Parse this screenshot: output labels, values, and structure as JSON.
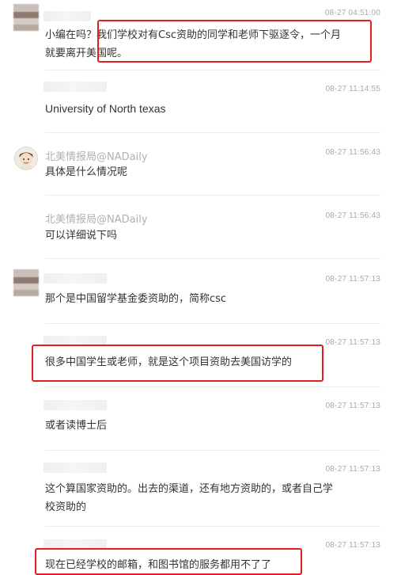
{
  "comments": [
    {
      "time": "08-27 04:51:00",
      "text_line1": "小编在吗？我们学校对有Csc资助的同学和老师下驱逐令，一个月",
      "text_line2": "就要离开美国呢。"
    },
    {
      "time": "08-27 11:14:55",
      "text": "University of North texas"
    },
    {
      "name": "北美情报局@NADaily",
      "time": "08-27 11:56:43",
      "text": "具体是什么情况呢"
    },
    {
      "name": "北美情报局@NADaily",
      "time": "08-27 11:56:43",
      "text": "可以详细说下吗"
    },
    {
      "time": "08-27 11:57:13",
      "text": "那个是中国留学基金委资助的，简称csc"
    },
    {
      "time": "08-27 11:57:13",
      "text": "很多中国学生或老师，就是这个项目资助去美国访学的"
    },
    {
      "time": "08-27 11:57:13",
      "text": "或者读博士后"
    },
    {
      "time": "08-27 11:57:13",
      "text_line1": "这个算国家资助的。出去的渠道，还有地方资助的，或者自己学",
      "text_line2": "校资助的"
    },
    {
      "time": "08-27 11:57:13",
      "text": "现在已经学校的邮箱，和图书馆的服务都用不了了"
    }
  ],
  "highlight_color": "#e21d24"
}
